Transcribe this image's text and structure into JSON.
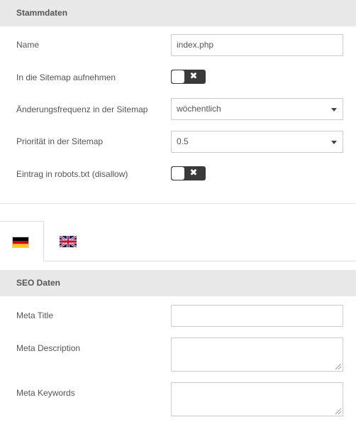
{
  "stammdaten": {
    "header": "Stammdaten",
    "name_label": "Name",
    "name_value": "index.php",
    "sitemap_label": "In die Sitemap aufnehmen",
    "sitemap_enabled": false,
    "frequency_label": "Änderungsfrequenz in der Sitemap",
    "frequency_value": "wöchentlich",
    "priority_label": "Priorität in der Sitemap",
    "priority_value": "0.5",
    "robots_label": "Eintrag in robots.txt (disallow)",
    "robots_enabled": false,
    "toggle_off_symbol": "✖"
  },
  "languages": {
    "tabs": [
      {
        "id": "de",
        "icon": "german-flag-icon",
        "active": true
      },
      {
        "id": "en",
        "icon": "british-flag-icon",
        "active": false
      }
    ]
  },
  "seo": {
    "header": "SEO Daten",
    "meta_title_label": "Meta Title",
    "meta_title_value": "",
    "meta_description_label": "Meta Description",
    "meta_description_value": "",
    "meta_keywords_label": "Meta Keywords",
    "meta_keywords_value": ""
  },
  "colors": {
    "header_bg": "#e8e8e8",
    "toggle_bg": "#3a3a3a",
    "border": "#cccccc"
  }
}
